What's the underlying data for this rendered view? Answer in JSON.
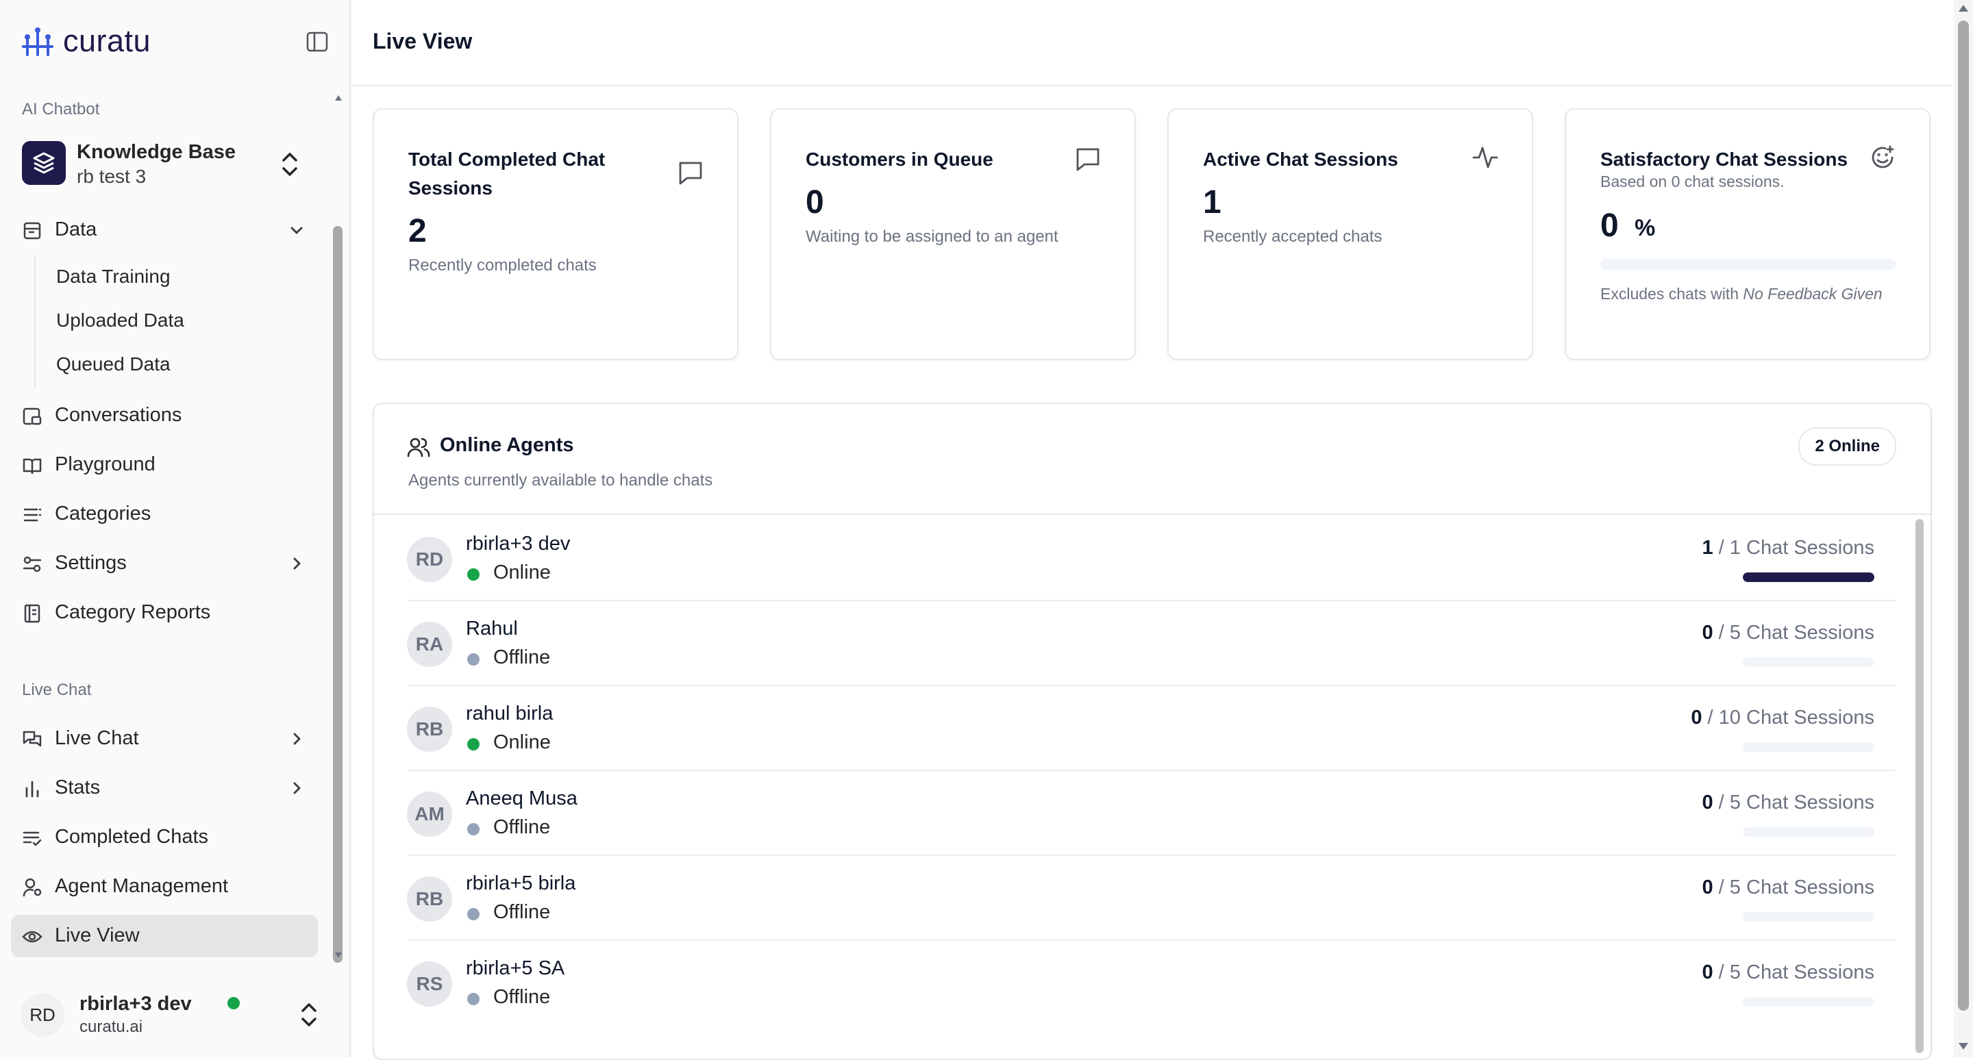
{
  "brand": {
    "name": "curatu"
  },
  "sidebar": {
    "section_chatbot": "AI Chatbot",
    "workspace": {
      "name": "Knowledge Base",
      "subtitle": "rb test 3"
    },
    "data_group": {
      "label": "Data",
      "children": [
        "Data Training",
        "Uploaded Data",
        "Queued Data"
      ]
    },
    "items_chatbot": [
      {
        "label": "Conversations",
        "icon": "chat-doc-icon"
      },
      {
        "label": "Playground",
        "icon": "book-icon"
      },
      {
        "label": "Categories",
        "icon": "list-icon"
      },
      {
        "label": "Settings",
        "icon": "sliders-icon"
      },
      {
        "label": "Category Reports",
        "icon": "report-icon"
      }
    ],
    "section_livechat": "Live Chat",
    "items_livechat": [
      {
        "label": "Live Chat",
        "icon": "messages-icon"
      },
      {
        "label": "Stats",
        "icon": "bar-chart-icon"
      },
      {
        "label": "Completed Chats",
        "icon": "list-check-icon"
      },
      {
        "label": "Agent Management",
        "icon": "user-gear-icon"
      },
      {
        "label": "Live View",
        "icon": "eye-icon"
      }
    ],
    "user": {
      "initials": "RD",
      "name": "rbirla+3 dev",
      "org": "curatu.ai"
    }
  },
  "main": {
    "title": "Live View",
    "stats": [
      {
        "title": "Total Completed Chat Sessions",
        "value": "2",
        "sub": "Recently completed chats",
        "icon": "message-square-icon"
      },
      {
        "title": "Customers in Queue",
        "value": "0",
        "sub": "Waiting to be assigned to an agent",
        "icon": "message-square-icon"
      },
      {
        "title": "Active Chat Sessions",
        "value": "1",
        "sub": "Recently accepted chats",
        "icon": "activity-icon"
      },
      {
        "title": "Satisfactory Chat Sessions",
        "subtitle": "Based on 0 chat sessions.",
        "value": "0",
        "unit": "%",
        "progress": 0,
        "note_prefix": "Excludes chats with ",
        "note_em": "No Feedback Given",
        "icon": "smile-plus-icon"
      }
    ],
    "agents": {
      "title": "Online Agents",
      "subtitle": "Agents currently available to handle chats",
      "badge": "2 Online",
      "sessions_label": "Chat Sessions",
      "list": [
        {
          "initials": "RD",
          "name": "rbirla+3 dev",
          "status": "Online",
          "active": "1",
          "max": "1",
          "fill": 1.0
        },
        {
          "initials": "RA",
          "name": "Rahul",
          "status": "Offline",
          "active": "0",
          "max": "5",
          "fill": 0
        },
        {
          "initials": "RB",
          "name": "rahul birla",
          "status": "Online",
          "active": "0",
          "max": "10",
          "fill": 0
        },
        {
          "initials": "AM",
          "name": "Aneeq Musa",
          "status": "Offline",
          "active": "0",
          "max": "5",
          "fill": 0
        },
        {
          "initials": "RB",
          "name": "rbirla+5 birla",
          "status": "Offline",
          "active": "0",
          "max": "5",
          "fill": 0
        },
        {
          "initials": "RS",
          "name": "rbirla+5 SA",
          "status": "Offline",
          "active": "0",
          "max": "5",
          "fill": 0
        }
      ]
    }
  },
  "colors": {
    "online": "#16a34a",
    "offline": "#94a3b8",
    "brand": "#1e1b4b",
    "accent": "#3b5bdb"
  }
}
